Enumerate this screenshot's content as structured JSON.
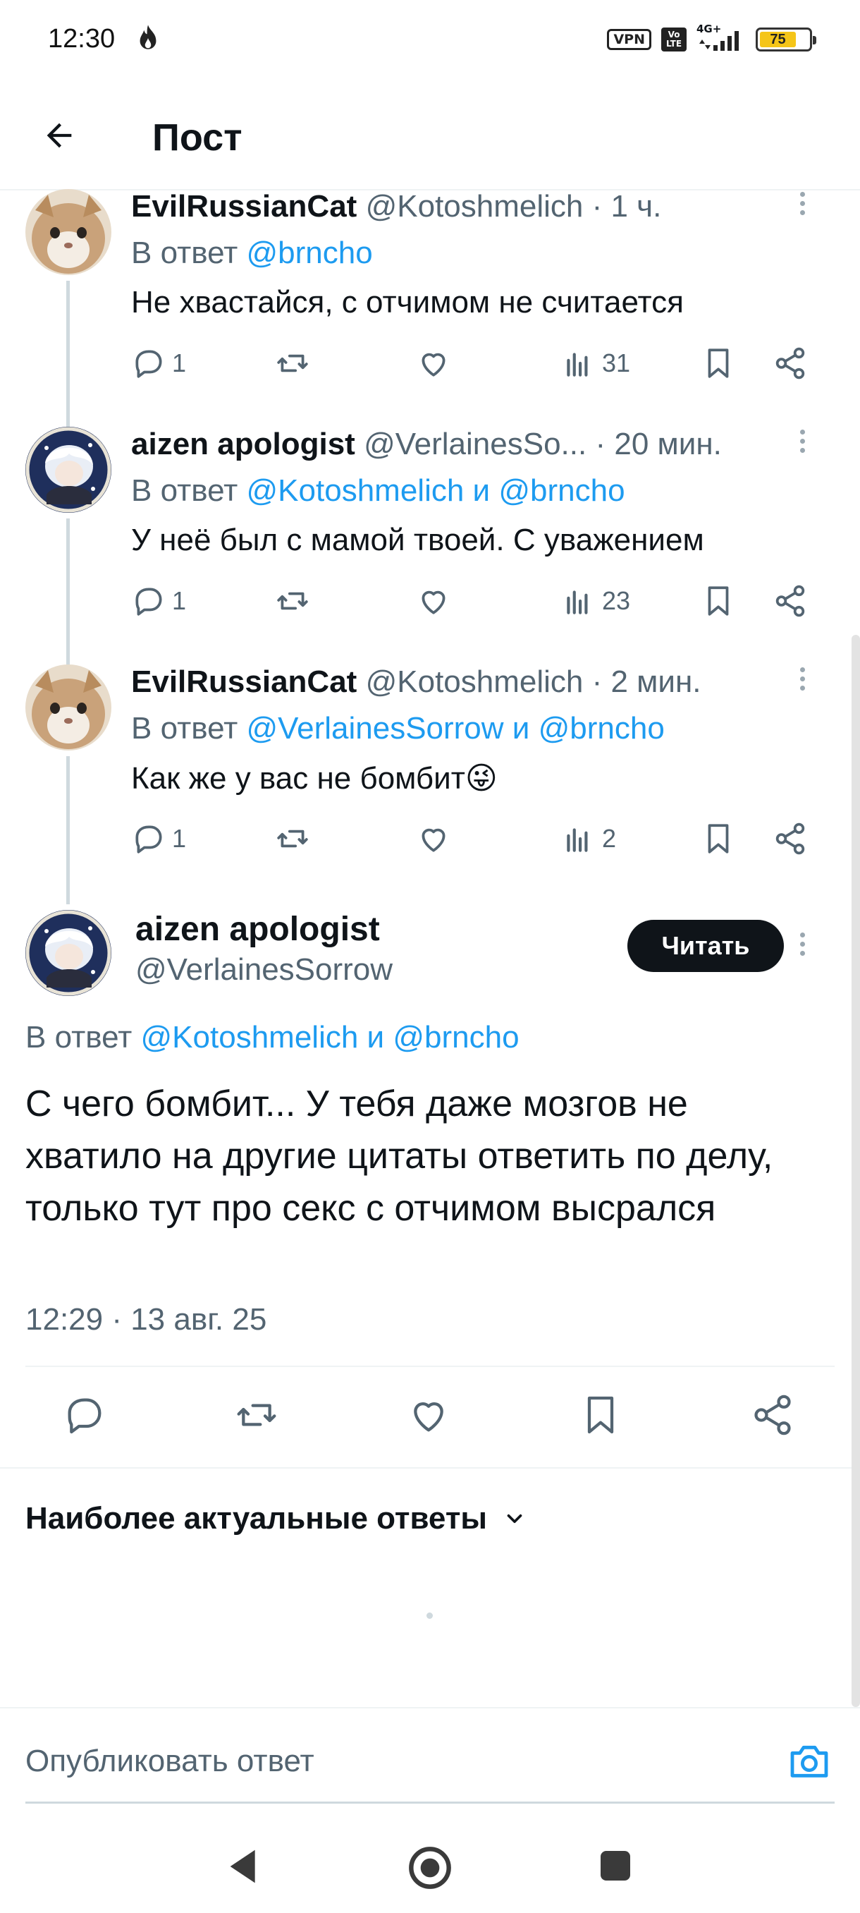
{
  "status_bar": {
    "time": "12:30",
    "vpn_label": "VPN",
    "volte_top": "Vo",
    "volte_bottom": "LTE",
    "network": "4G+",
    "battery": "75"
  },
  "header": {
    "title": "Пост"
  },
  "thread": [
    {
      "name": "EvilRussianCat",
      "handle": "@Kotoshmelich",
      "time": "· 1 ч.",
      "reply_prefix": "В ответ",
      "reply_mentions": "@brncho",
      "text": "Не хвастайся, с отчимом не считается",
      "replies": "1",
      "views": "31",
      "avatar": "cat-avatar"
    },
    {
      "name": "aizen apologist",
      "handle": "@VerlainesSo...",
      "time": "· 20 мин.",
      "reply_prefix": "В ответ",
      "reply_mentions": "@Kotoshmelich и @brncho",
      "text": "У неё был с мамой твоей. С уважением",
      "replies": "1",
      "views": "23",
      "avatar": "anime-avatar"
    },
    {
      "name": "EvilRussianCat",
      "handle": "@Kotoshmelich",
      "time": "· 2 мин.",
      "reply_prefix": "В ответ",
      "reply_mentions": "@VerlainesSorrow и @brncho",
      "text": "Как же у вас не бомбит😜",
      "replies": "1",
      "views": "2",
      "avatar": "cat-avatar"
    }
  ],
  "main_tweet": {
    "name": "aizen apologist",
    "handle": "@VerlainesSorrow",
    "follow_label": "Читать",
    "reply_prefix": "В ответ",
    "reply_mentions": "@Kotoshmelich и @brncho",
    "text": "С чего бомбит... У тебя даже мозгов не хватило на другие цитаты ответить по делу, только тут про секс с отчимом высрался",
    "timestamp": "12:29 · 13 авг. 25"
  },
  "replies_section": {
    "sort_label": "Наиболее актуальные ответы"
  },
  "compose": {
    "placeholder": "Опубликовать ответ"
  },
  "colors": {
    "accent": "#1d9bf0",
    "text": "#0f1419",
    "secondary": "#536471",
    "divider": "#eff3f4"
  },
  "icons": [
    "back-arrow-icon",
    "reply-icon",
    "retweet-icon",
    "like-icon",
    "views-icon",
    "bookmark-icon",
    "share-icon",
    "more-icon",
    "camera-icon",
    "chevron-down-icon"
  ]
}
